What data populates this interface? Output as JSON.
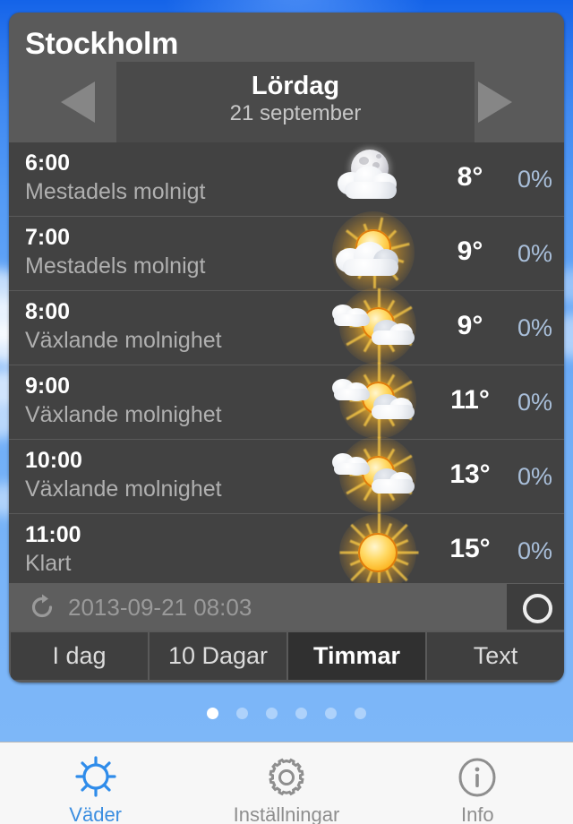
{
  "app": {
    "city": "Stockholm"
  },
  "daynav": {
    "prev_icon": "left-triangle-icon",
    "next_icon": "right-triangle-icon",
    "day_name": "Lördag",
    "day_date": "21 september"
  },
  "forecast": {
    "rows": [
      {
        "time": "6:00",
        "desc": "Mestadels molnigt",
        "temp": "8°",
        "precip": "0%",
        "icon": "moon-behind-cloud-icon"
      },
      {
        "time": "7:00",
        "desc": "Mestadels molnigt",
        "temp": "9°",
        "precip": "0%",
        "icon": "sun-behind-cloud-icon"
      },
      {
        "time": "8:00",
        "desc": "Växlande molnighet",
        "temp": "9°",
        "precip": "0%",
        "icon": "sun-between-clouds-icon"
      },
      {
        "time": "9:00",
        "desc": "Växlande molnighet",
        "temp": "11°",
        "precip": "0%",
        "icon": "sun-between-clouds-icon"
      },
      {
        "time": "10:00",
        "desc": "Växlande molnighet",
        "temp": "13°",
        "precip": "0%",
        "icon": "sun-between-clouds-icon"
      },
      {
        "time": "11:00",
        "desc": "Klart",
        "temp": "15°",
        "precip": "0%",
        "icon": "sun-icon"
      }
    ]
  },
  "refresh": {
    "icon": "refresh-icon",
    "timestamp": "2013-09-21 08:03",
    "location_icon": "circle-ring-icon"
  },
  "segments": {
    "items": [
      {
        "label": "I dag",
        "active": false
      },
      {
        "label": "10 Dagar",
        "active": false
      },
      {
        "label": "Timmar",
        "active": true
      },
      {
        "label": "Text",
        "active": false
      }
    ]
  },
  "pager": {
    "count": 6,
    "active_index": 0
  },
  "tabbar": {
    "items": [
      {
        "label": "Väder",
        "icon": "sun-icon",
        "active": true
      },
      {
        "label": "Inställningar",
        "icon": "gear-icon",
        "active": false
      },
      {
        "label": "Info",
        "icon": "info-icon",
        "active": false
      }
    ]
  },
  "colors": {
    "accent": "#3b8ee0",
    "precip": "#a9bfda",
    "panel": "#5a5a5a",
    "row": "#424242"
  }
}
